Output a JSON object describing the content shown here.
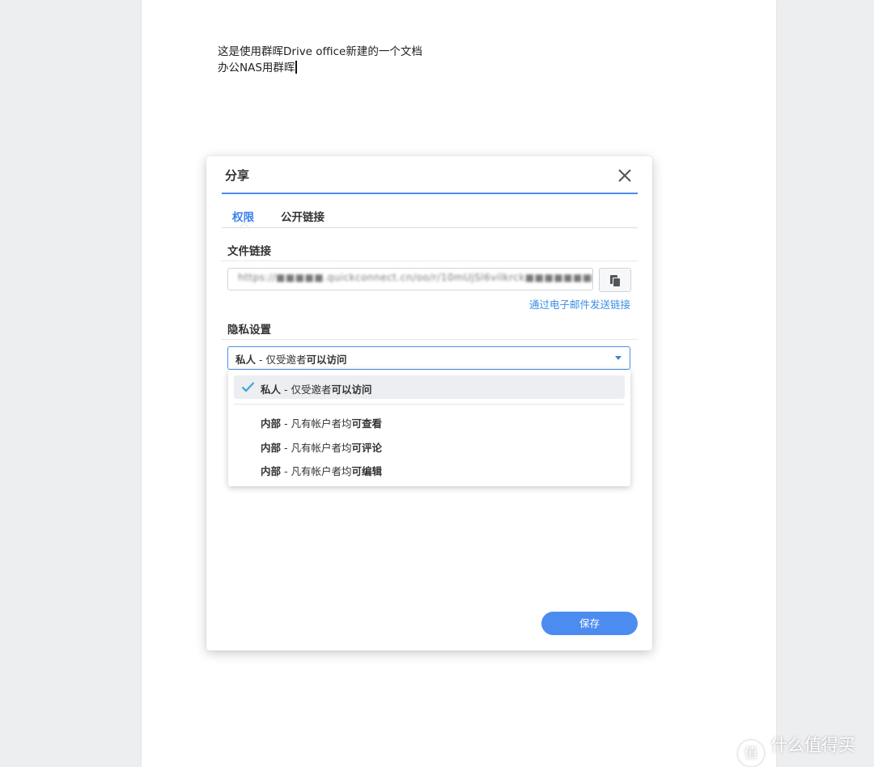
{
  "document": {
    "line1": "这是使用群晖Drive office新建的一个文档",
    "line2": "办公NAS用群晖"
  },
  "dialog": {
    "title": "分享",
    "tabs": [
      {
        "label": "权限",
        "active": true
      },
      {
        "label": "公开链接",
        "active": false
      }
    ],
    "file_link": {
      "label": "文件链接",
      "value": "https://■■■■■.quickconnect.cn/oo/r/10mUjSl6vilkrck■■■■■■■■■■■■■■6k",
      "email_link": "通过电子邮件发送链接"
    },
    "privacy": {
      "label": "隐私设置",
      "selected": {
        "prefix": "私人",
        "middle": " - 仅受邀者",
        "suffix": "可以访问"
      },
      "options": [
        {
          "prefix": "私人",
          "middle": " - 仅受邀者",
          "suffix": "可以访问",
          "selected": true
        },
        {
          "prefix": "内部",
          "middle": " - 凡有帐户者均",
          "suffix": "可查看",
          "selected": false
        },
        {
          "prefix": "内部",
          "middle": " - 凡有帐户者均",
          "suffix": "可评论",
          "selected": false
        },
        {
          "prefix": "内部",
          "middle": " - 凡有帐户者均",
          "suffix": "可编辑",
          "selected": false
        }
      ]
    },
    "save_label": "保存"
  },
  "watermark": {
    "logo_glyph": "值",
    "text": "什么值得买"
  },
  "colors": {
    "accent": "#4c8cf0",
    "link": "#3a8ee6",
    "check": "#3fa4d9",
    "background": "#edeef0"
  },
  "icons": {
    "close": "close-icon",
    "copy": "copy-icon",
    "check": "check-icon",
    "dropdown": "chevron-down-icon"
  }
}
